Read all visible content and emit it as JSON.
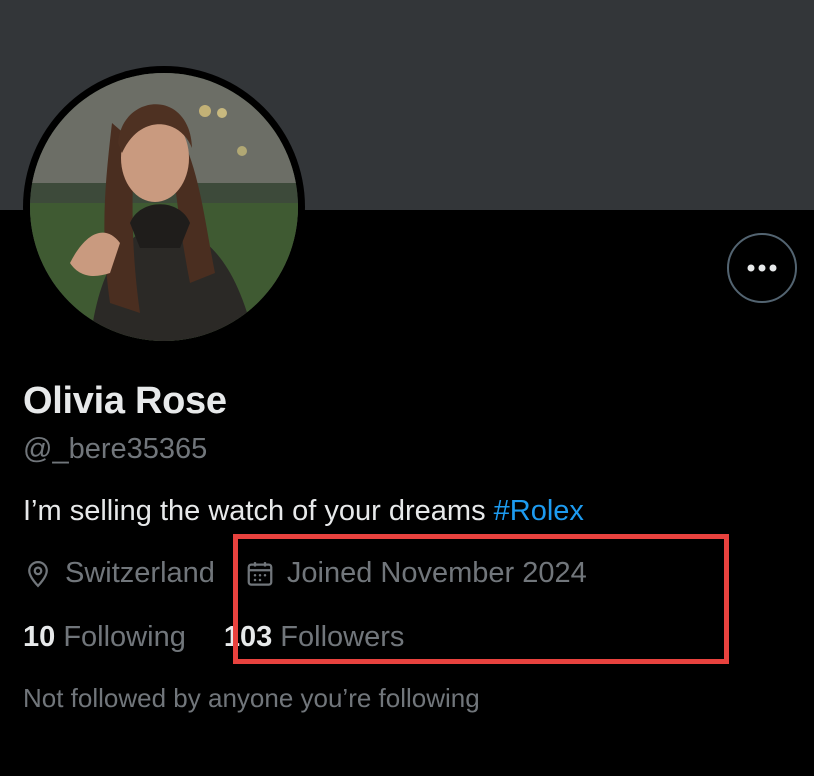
{
  "profile": {
    "name": "Olivia Rose",
    "handle": "@_bere35365",
    "bio_text": "I’m selling the watch of your dreams ",
    "bio_hashtag": "#Rolex",
    "location": "Switzerland",
    "joined": "Joined November 2024",
    "following_count": "10",
    "following_label": "Following",
    "followers_count": "103",
    "followers_label": "Followers",
    "mutual_note": "Not followed by anyone you’re following"
  },
  "icons": {
    "more": "more-horizontal-icon",
    "location": "location-pin-icon",
    "calendar": "calendar-icon"
  },
  "colors": {
    "background": "#000000",
    "banner": "#333639",
    "primary_text": "#e7e9ea",
    "secondary_text": "#71767b",
    "hashtag": "#1d9bf0",
    "annotation_box": "#e8423e"
  }
}
